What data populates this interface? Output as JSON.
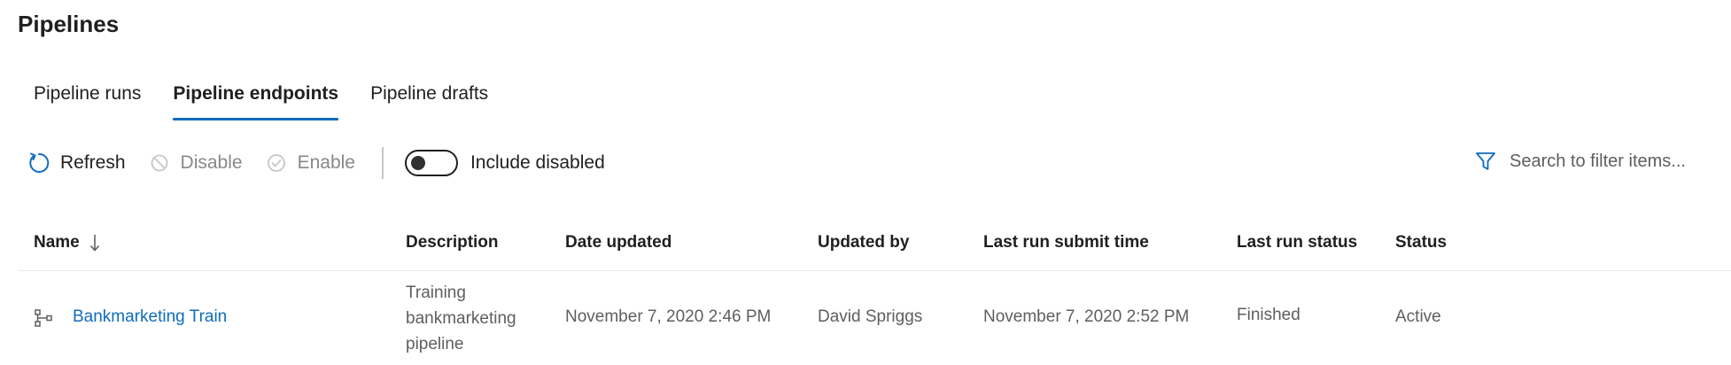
{
  "page": {
    "title": "Pipelines"
  },
  "tabs": [
    {
      "label": "Pipeline runs"
    },
    {
      "label": "Pipeline endpoints",
      "active": true
    },
    {
      "label": "Pipeline drafts"
    }
  ],
  "toolbar": {
    "refresh_label": "Refresh",
    "disable_label": "Disable",
    "enable_label": "Enable",
    "include_disabled_label": "Include disabled",
    "include_disabled_on": false
  },
  "search": {
    "placeholder": "Search to filter items..."
  },
  "table": {
    "columns": {
      "name": "Name",
      "description": "Description",
      "date_updated": "Date updated",
      "updated_by": "Updated by",
      "last_run_submit_time": "Last run submit time",
      "last_run_status": "Last run status",
      "status": "Status"
    },
    "sort": {
      "column": "name",
      "direction": "descending"
    },
    "rows": [
      {
        "name": "Bankmarketing Train",
        "description": "Training bankmarketing pipeline",
        "date_updated": "November 7, 2020 2:46 PM",
        "updated_by": "David Spriggs",
        "last_run_submit_time": "November 7, 2020 2:52 PM",
        "last_run_status": "Finished",
        "status": "Active"
      }
    ]
  },
  "icons": {
    "refresh": "refresh-icon",
    "disable": "disable-icon",
    "enable": "check-circle-icon",
    "filter": "filter-icon",
    "sort": "arrow-down-icon",
    "pipeline": "pipeline-icon"
  },
  "colors": {
    "accent": "#0f6cbd",
    "disabled_text": "#8a8886",
    "secondary_text": "#605e5c"
  }
}
